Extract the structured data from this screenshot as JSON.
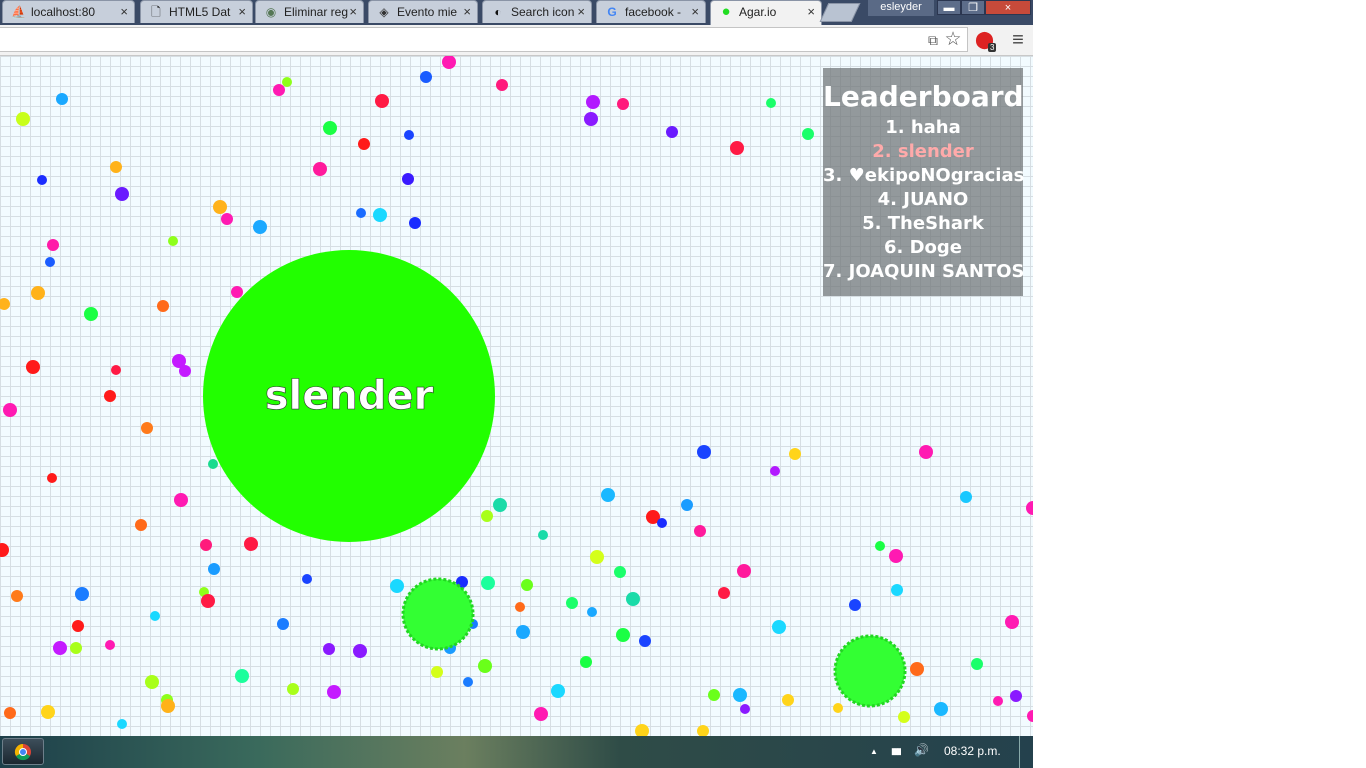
{
  "tabs": [
    {
      "title": "localhost:80",
      "icon": "pma-icon",
      "glyph": "⛵",
      "active": false
    },
    {
      "title": "HTML5 Dat",
      "icon": "document-icon",
      "glyph": "🗋",
      "active": false
    },
    {
      "title": "Eliminar reg",
      "icon": "badge-icon",
      "glyph": "◉",
      "active": false
    },
    {
      "title": "Evento mie",
      "icon": "eye-logo-icon",
      "glyph": "◈",
      "active": false
    },
    {
      "title": "Search icon",
      "icon": "search-logo-icon",
      "glyph": "◐",
      "active": false
    },
    {
      "title": "facebook -",
      "icon": "google-icon",
      "glyph": "G",
      "active": false
    },
    {
      "title": "Agar.io",
      "icon": "agar-icon",
      "glyph": "●",
      "active": true
    }
  ],
  "tab_close_glyph": "×",
  "window": {
    "user": "esleyder",
    "minimize": "▬",
    "restore": "❐",
    "close": "×"
  },
  "toolbar": {
    "translate_icon": "translate-icon",
    "translate_glyph": "⧉",
    "star_glyph": "☆",
    "extension_glyph": "⬤",
    "extension_badge": "3",
    "menu_glyph": "≡"
  },
  "game": {
    "player_name": "slender",
    "player_color": "#22ff00"
  },
  "leaderboard": {
    "title": "Leaderboard",
    "entries": [
      "1. haha",
      "2. slender",
      "3. ♥ekipoNOgracias",
      "4. JUANO",
      "5. TheShark",
      "6. Doge",
      "7. JOAQUIN SANTOS"
    ],
    "highlight_color": "#ffaaaa"
  },
  "taskbar": {
    "time": "08:32 p.m.",
    "tray_up": "▲",
    "signal": "▮▮▮",
    "volume": "🔊",
    "start_icon": "chrome-icon"
  }
}
